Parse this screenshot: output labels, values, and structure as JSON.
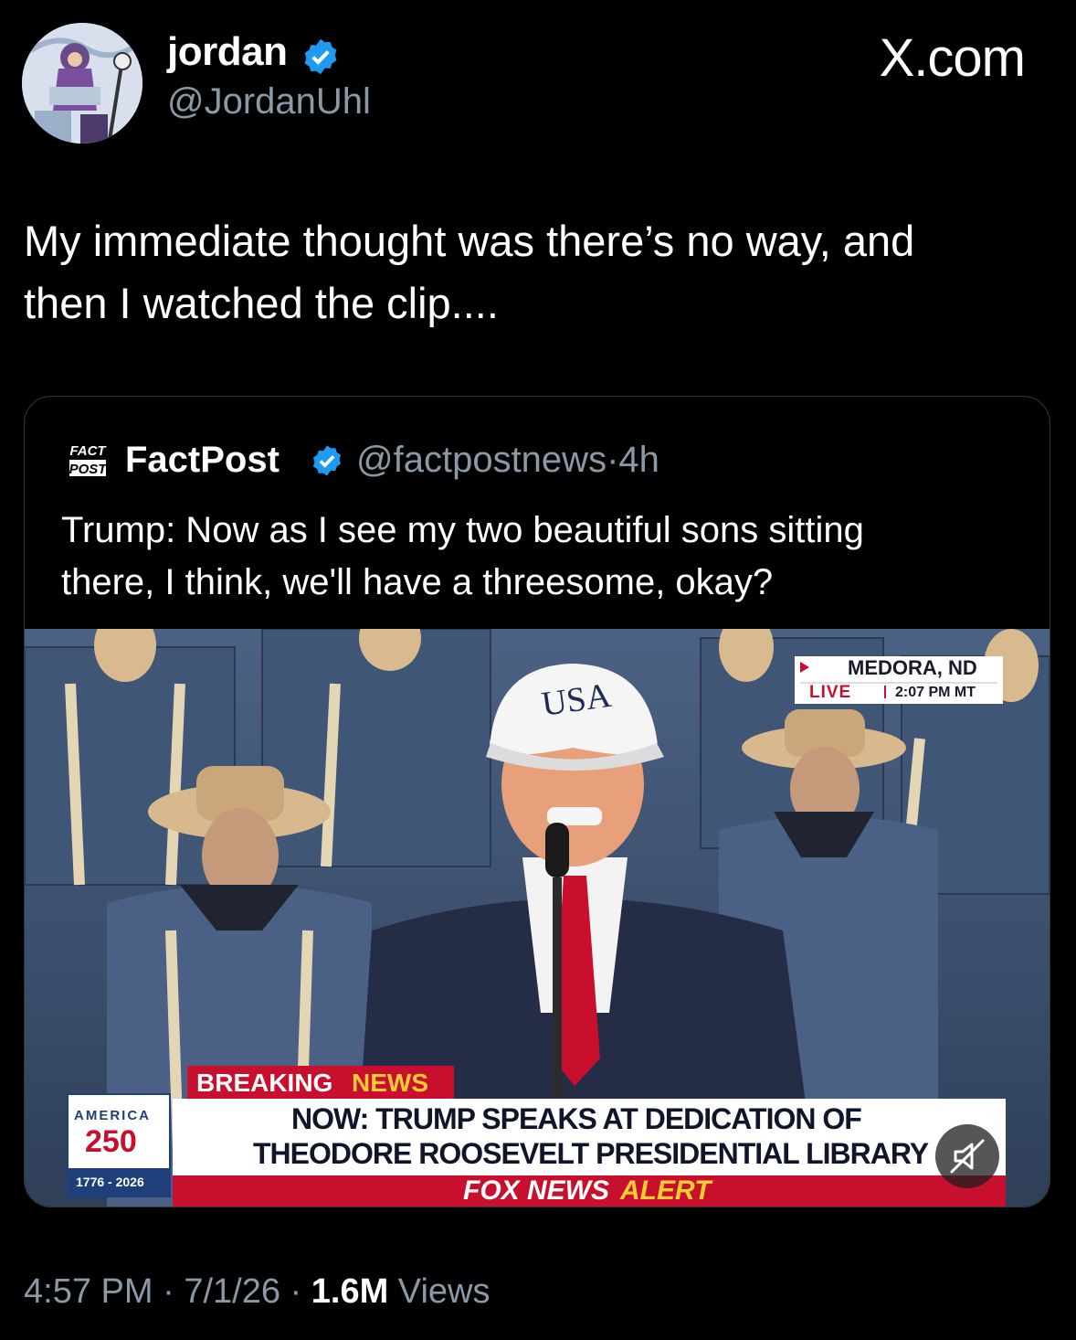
{
  "author": {
    "name": "jordan",
    "handle": "@JordanUhl",
    "verified": true
  },
  "watermark": "X.com",
  "tweet": {
    "text_lines": [
      "My immediate thought was there’s no way, and",
      "then I watched the clip...."
    ]
  },
  "quote": {
    "logo_lines": [
      "FACT",
      "POST"
    ],
    "name": "FactPost",
    "handle": "@factpostnews",
    "separator": "·",
    "time": "4h",
    "text_lines": [
      "Trump: Now as I see my two beautiful sons sitting",
      "there, I think, we'll have a threesome, okay?"
    ],
    "video": {
      "location": "MEDORA, ND",
      "live_label": "LIVE",
      "live_time": "2:07 PM MT",
      "hat_text": "USA",
      "america_label": "AMERICA",
      "america_number": "250",
      "america_years": "1776 - 2026",
      "breaking_word1": "BREAKING",
      "breaking_word2": "NEWS",
      "headline_line1": "NOW: TRUMP SPEAKS AT DEDICATION OF",
      "headline_line2": "THEODORE ROOSEVELT PRESIDENTIAL LIBRARY",
      "alert_word1": "FOX NEWS",
      "alert_word2": "ALERT",
      "muted": true
    }
  },
  "footer": {
    "time": "4:57 PM",
    "sep1": "·",
    "date": "7/1/26",
    "sep2": "·",
    "views_count": "1.6M",
    "views_label": "Views"
  },
  "colors": {
    "verified": "#1d9bf0",
    "muted_text": "#8b98a5",
    "fox_red": "#c8102e"
  }
}
